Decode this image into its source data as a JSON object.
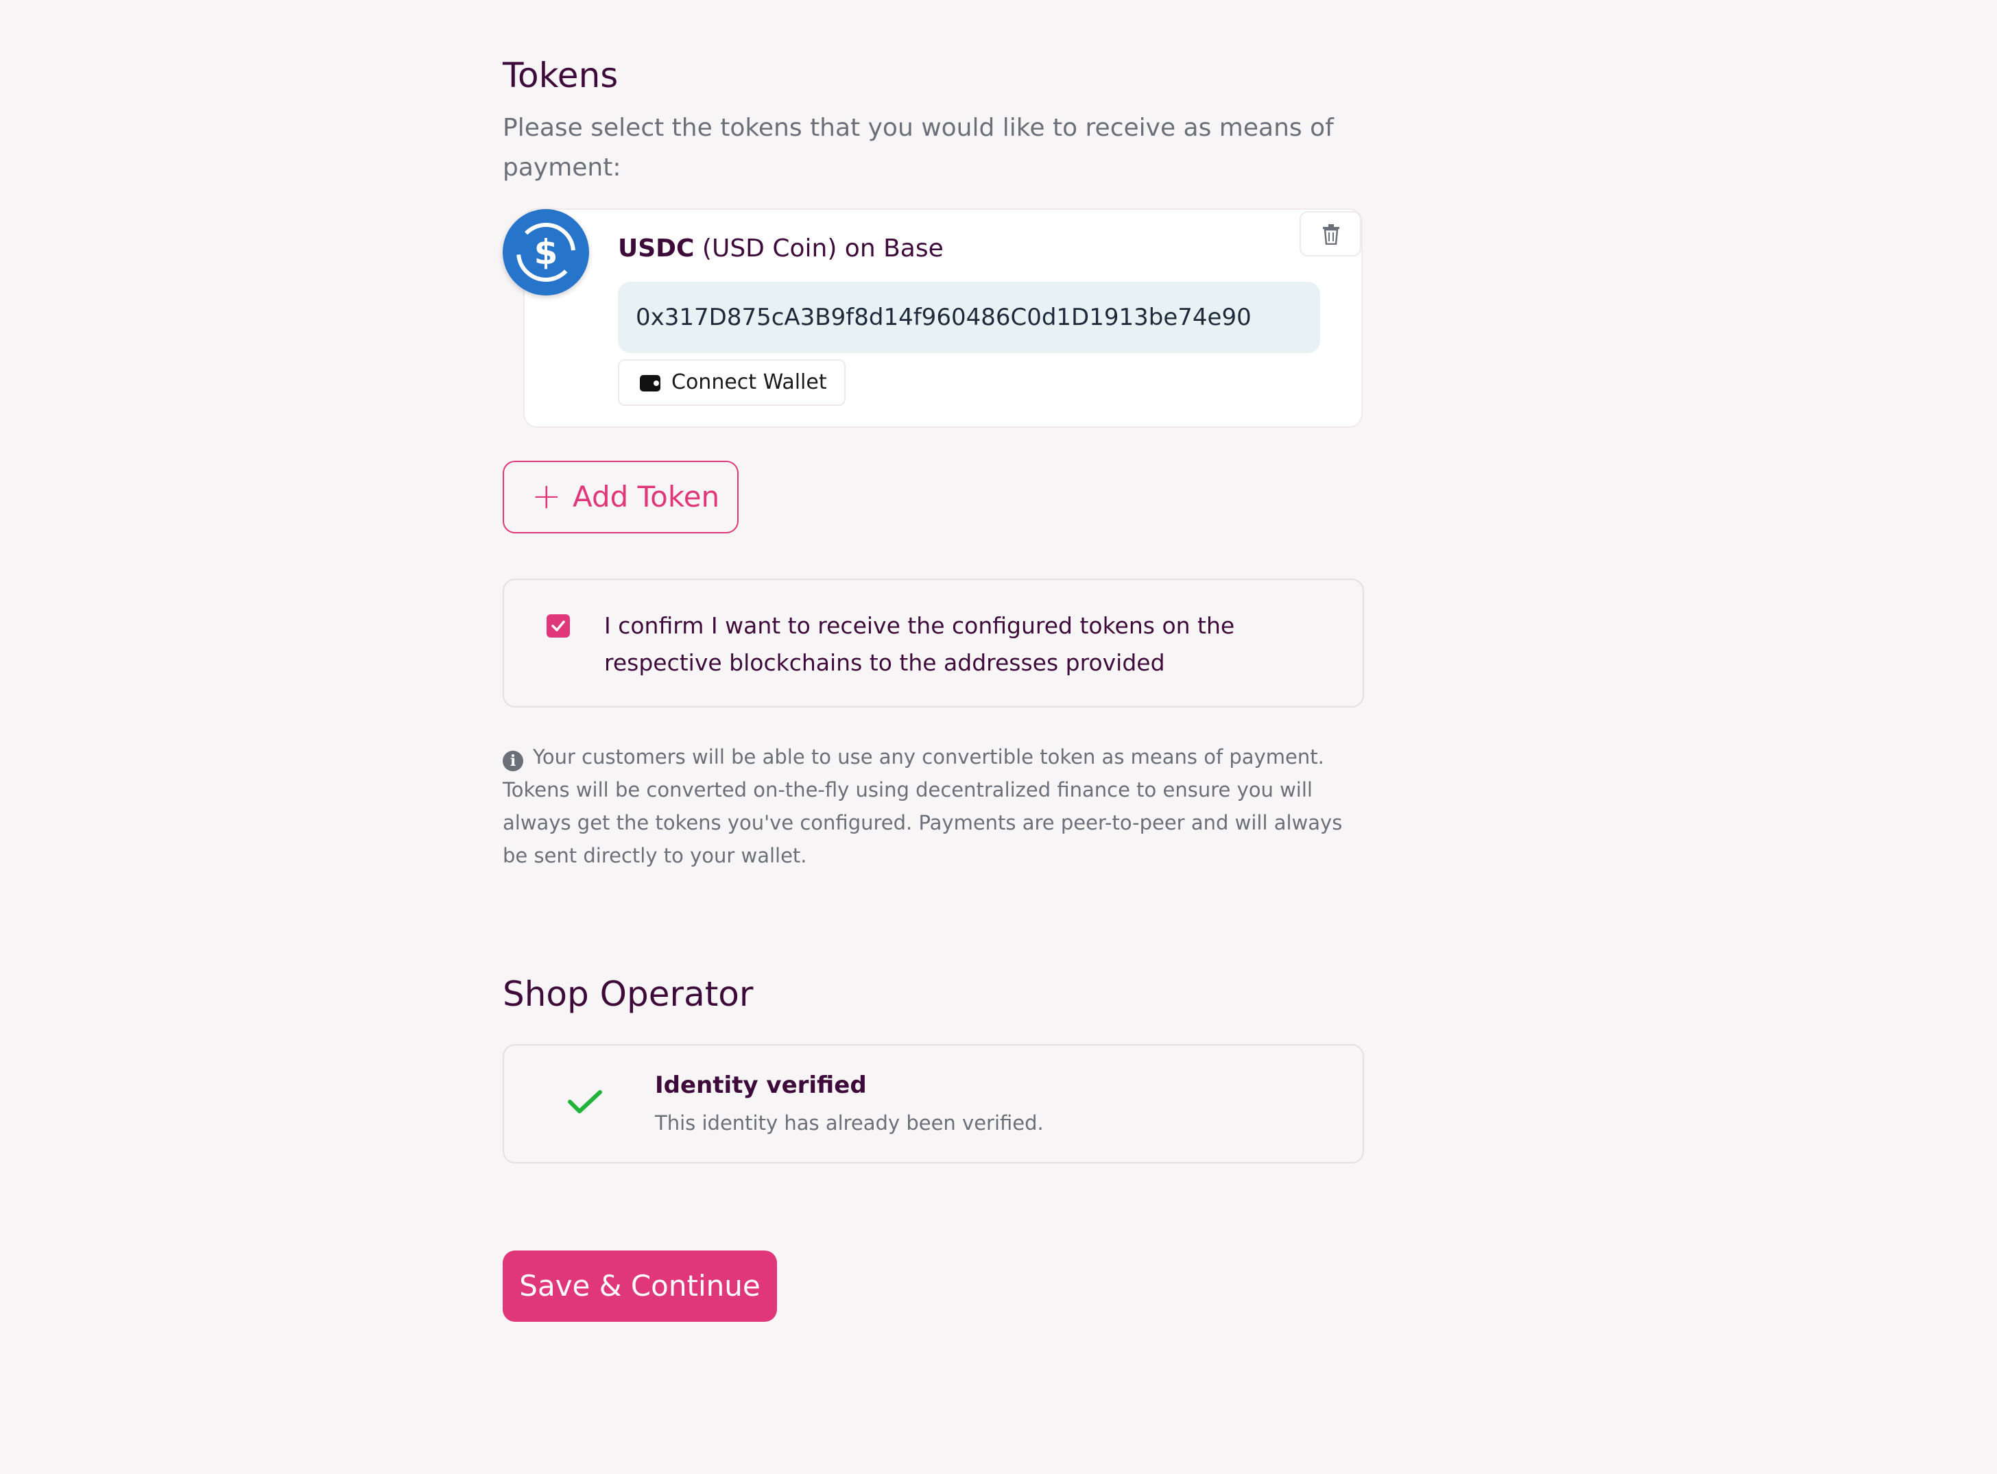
{
  "tokens": {
    "heading": "Tokens",
    "description": "Please select the tokens that you would like to receive as means of payment:",
    "items": [
      {
        "symbol": "USDC",
        "name_rest": "(USD Coin) on Base",
        "icon": "usdc-coin-icon",
        "address": "0x317D875cA3B9f8d14f960486C0d1D1913be74e90",
        "connect_label": "Connect Wallet"
      }
    ],
    "add_label": "Add Token",
    "confirm_text": "I confirm I want to receive the configured tokens on the respective blockchains to the addresses provided",
    "confirm_checked": true,
    "info_text": "Your customers will be able to use any convertible token as means of payment. Tokens will be converted on-the-fly using decentralized finance to ensure you will always get the tokens you've configured. Payments are peer-to-peer and will always be sent directly to your wallet."
  },
  "operator": {
    "heading": "Shop Operator",
    "verified_title": "Identity verified",
    "verified_subtitle": "This identity has already been verified."
  },
  "actions": {
    "save_label": "Save & Continue"
  },
  "colors": {
    "accent": "#e0377a",
    "heading": "#3d0a3a",
    "usdc_blue": "#2775ca",
    "success": "#22b33a",
    "background": "#f8f5f6"
  }
}
